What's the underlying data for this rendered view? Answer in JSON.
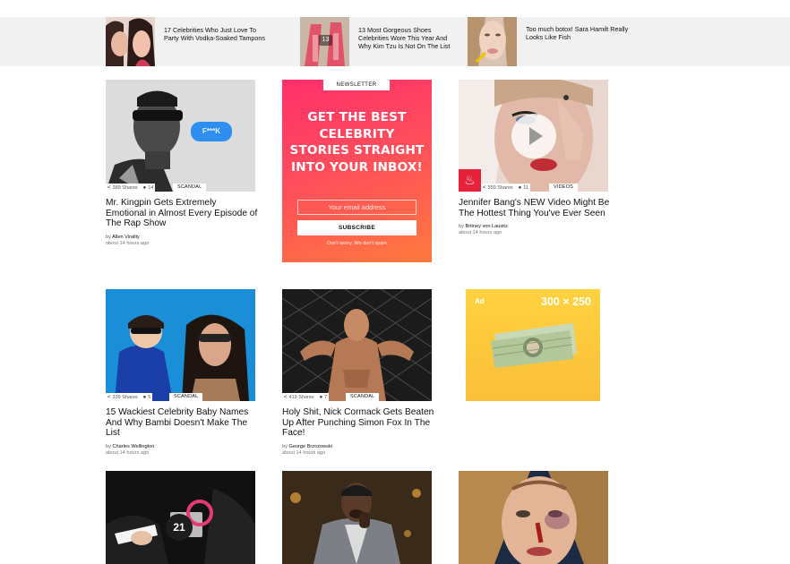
{
  "top_strip": [
    {
      "title": "17 Celebrities Who Just Love To Party With Vodka-Soaked Tampons",
      "icon": "celebrity-photo"
    },
    {
      "title": "13 Most Gorgeous Shoes Celebrities Wore This Year And Why Kim Tzu Is Not On The List",
      "icon": "shoes-photo",
      "badge": "13"
    },
    {
      "title": "Too much botox! Sara Hamilt Really Looks Like Fish",
      "icon": "face-photo"
    }
  ],
  "cards": [
    {
      "title": "Mr. Kingpin Gets Extremely Emotional in Almost Every Episode of The Rap Show",
      "shares": "389 Shares",
      "comments": "14",
      "tag": "SCANDAL",
      "author": "Allen Virality",
      "time": "about 14 hours ago",
      "bubble": "F***K"
    },
    {
      "title": "Jennifer Bang's NEW Video Might Be The Hottest Thing You've Ever Seen",
      "shares": "359 Shares",
      "comments": "11",
      "tag": "VIDEOS",
      "author": "Britney von Lausitz",
      "time": "about 14 hours ago"
    },
    {
      "title": "15 Wackiest Celebrity Baby Names And Why Bambi Doesn't Make The List",
      "shares": "339 Shares",
      "comments": "5",
      "tag": "SCANDAL",
      "author": "Charles Wellington",
      "time": "about 14 hours ago"
    },
    {
      "title": "Holy Shit, Nick Cormack Gets Beaten Up After Punching Simon Fox In The Face!",
      "shares": "419 Shares",
      "comments": "7",
      "tag": "SCANDAL",
      "author": "George Brzozowski",
      "time": "about 14 hours ago"
    }
  ],
  "by_label": "by",
  "newsletter": {
    "label": "NEWSLETTER",
    "headline": "GET THE BEST CELEBRITY STORIES STRAIGHT INTO YOUR INBOX!",
    "placeholder": "Your email address",
    "button": "SUBSCRIBE",
    "note": "Don't worry. We don't spam"
  },
  "ad": {
    "label": "Ad",
    "size": "300 × 250"
  },
  "bottom": {
    "gallery_count": "21"
  },
  "colors": {
    "accent": "#ff2f6a",
    "fire": "#e8213b",
    "ad": "#fbbf3a"
  }
}
